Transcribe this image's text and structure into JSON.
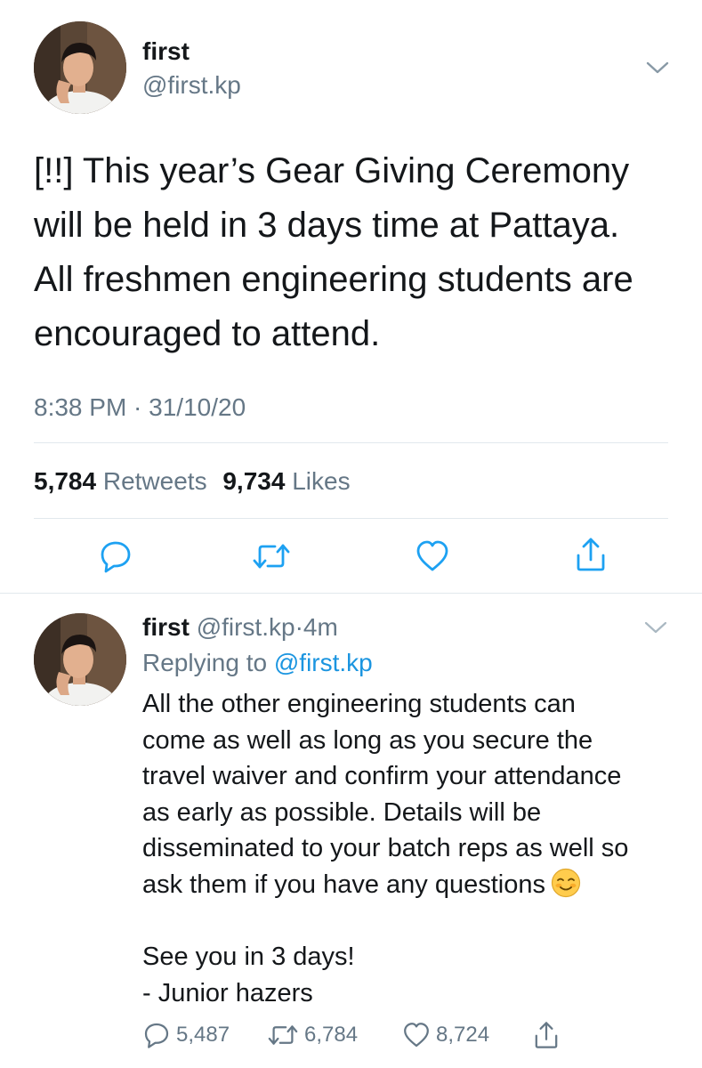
{
  "main_tweet": {
    "display_name": "first",
    "handle": "@first.kp",
    "text_lines": [
      "[!!] This year’s Gear Giving Ceremony",
      "will be held in 3 days time at Pattaya.",
      "All freshmen engineering students are",
      "encouraged to attend."
    ],
    "timestamp": "8:38 PM · 31/10/20",
    "retweets_count": "5,784",
    "retweets_label": "Retweets",
    "likes_count": "9,734",
    "likes_label": "Likes",
    "icons": {
      "avatar": "profile-photo",
      "menu": "chevron-down-icon",
      "reply": "reply-icon",
      "retweet": "retweet-icon",
      "like": "heart-icon",
      "share": "share-icon"
    }
  },
  "reply": {
    "display_name": "first",
    "handle": "@first.kp",
    "separator": "·",
    "age": "4m",
    "replying_to_prefix": "Replying to",
    "replying_to_handle": "@first.kp",
    "text_lines": [
      "All the other engineering students can",
      "come as well as long as you secure the",
      "travel waiver and confirm your attendance",
      "as early as possible. Details will be",
      "disseminated to your batch reps as well so",
      "ask them if you have any questions",
      "",
      "See you in 3 days!",
      "- Junior hazers"
    ],
    "emoji": "smiling-face-emoji",
    "reply_count": "5,487",
    "retweet_count": "6,784",
    "like_count": "8,724"
  },
  "colors": {
    "text": "#14171a",
    "secondary": "#657786",
    "link": "#1b95e0",
    "divider": "#e1e8ed",
    "icon": "#1da1f2"
  }
}
